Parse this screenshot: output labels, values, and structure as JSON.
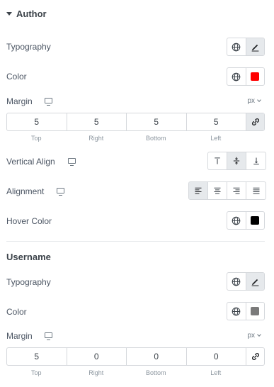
{
  "author": {
    "title": "Author",
    "typography_label": "Typography",
    "color_label": "Color",
    "color_value": "#ff0000",
    "margin_label": "Margin",
    "margin_unit": "px",
    "margin_values": [
      "5",
      "5",
      "5",
      "5"
    ],
    "vertical_align_label": "Vertical Align",
    "alignment_label": "Alignment",
    "hover_color_label": "Hover Color",
    "hover_color_value": "#000000"
  },
  "username": {
    "title": "Username",
    "typography_label": "Typography",
    "color_label": "Color",
    "color_value": "#7a7a7a",
    "margin_label": "Margin",
    "margin_unit": "px",
    "margin_values": [
      "5",
      "0",
      "0",
      "0"
    ]
  },
  "dimension_labels": [
    "Top",
    "Right",
    "Bottom",
    "Left"
  ],
  "icons": {
    "global": "globe-icon",
    "edit": "pencil-icon",
    "responsive": "monitor-icon",
    "link": "link-icon",
    "align_top": "align-top-icon",
    "align_middle": "align-middle-icon",
    "align_bottom": "align-bottom-icon",
    "text_left": "text-align-left-icon",
    "text_center": "text-align-center-icon",
    "text_right": "text-align-right-icon",
    "text_justify": "text-align-justify-icon"
  }
}
